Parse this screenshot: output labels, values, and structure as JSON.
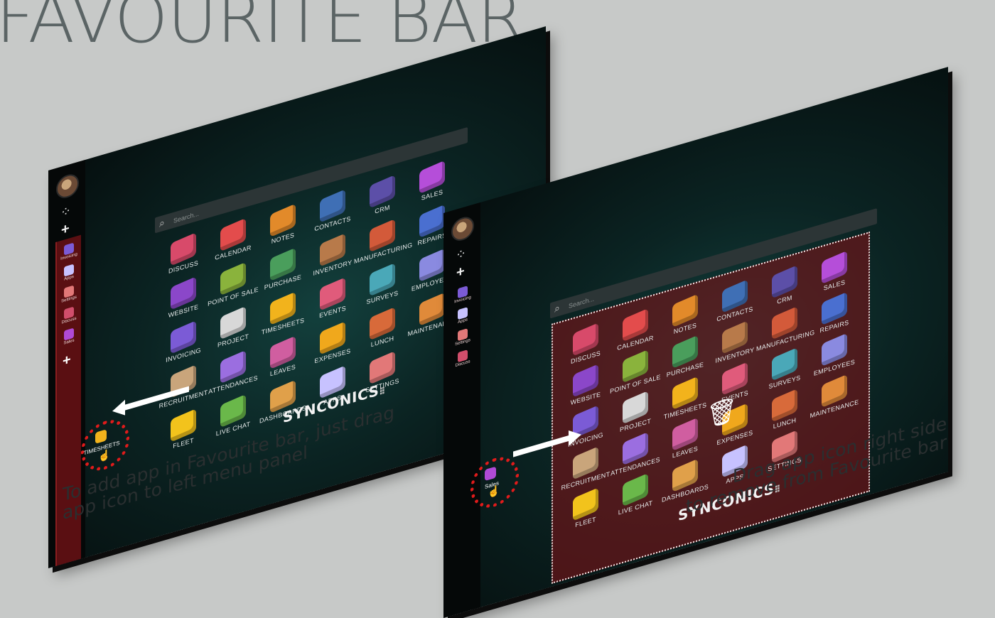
{
  "title": "FAVOURITE BAR",
  "captions": {
    "left": [
      "To add app in Favourite bar, just drag",
      "app icon to left menu panel"
    ],
    "right": [
      "Drag app icon right side",
      "to remove from Favourite bar"
    ]
  },
  "search": {
    "placeholder": "Search..."
  },
  "brand": {
    "name": "SYNCONICS"
  },
  "colors": {
    "accent_red": "#e01b1b",
    "fav_panel": "#5a0f12",
    "background": "#c7c9c8"
  },
  "left_screen": {
    "favourites": [
      {
        "label": "Invoicing",
        "icon": "invoicing-icon",
        "color": "#7b5bd6"
      },
      {
        "label": "Apps",
        "icon": "apps-icon",
        "color": "#c7c2ff"
      },
      {
        "label": "Settings",
        "icon": "settings-icon",
        "color": "#e27878"
      },
      {
        "label": "Discuss",
        "icon": "discuss-icon",
        "color": "#d04e6b"
      },
      {
        "label": "Sales",
        "icon": "sales-icon",
        "color": "#b04ad6"
      }
    ],
    "dragging": {
      "label": "TIMESHEETS",
      "icon": "timesheets-icon",
      "color": "#f2b31c"
    },
    "apps": [
      {
        "label": "DISCUSS",
        "icon": "discuss-icon",
        "color": "#d84a6a"
      },
      {
        "label": "CALENDAR",
        "icon": "calendar-icon",
        "color": "#e34c4c"
      },
      {
        "label": "NOTES",
        "icon": "notes-icon",
        "color": "#e28a2a"
      },
      {
        "label": "CONTACTS",
        "icon": "contacts-icon",
        "color": "#3f6fb5"
      },
      {
        "label": "CRM",
        "icon": "crm-icon",
        "color": "#5c4fa8"
      },
      {
        "label": "SALES",
        "icon": "sales-icon",
        "color": "#b54ed9"
      },
      {
        "label": "WEBSITE",
        "icon": "website-icon",
        "color": "#8b47c9"
      },
      {
        "label": "POINT OF SALE",
        "icon": "point-of-sale-icon",
        "color": "#8ab33c"
      },
      {
        "label": "PURCHASE",
        "icon": "purchase-icon",
        "color": "#4a9e5c"
      },
      {
        "label": "INVENTORY",
        "icon": "inventory-icon",
        "color": "#b87a4a"
      },
      {
        "label": "MANUFACTURING",
        "icon": "manufacturing-icon",
        "color": "#d35a3a"
      },
      {
        "label": "REPAIRS",
        "icon": "repairs-icon",
        "color": "#4a6fd0"
      },
      {
        "label": "INVOICING",
        "icon": "invoicing-icon",
        "color": "#7b5bd6"
      },
      {
        "label": "PROJECT",
        "icon": "project-icon",
        "color": "#d8d8d8"
      },
      {
        "label": "TIMESHEETS",
        "icon": "timesheets-icon",
        "color": "#f2b31c"
      },
      {
        "label": "EVENTS",
        "icon": "events-icon",
        "color": "#e05b7b"
      },
      {
        "label": "SURVEYS",
        "icon": "surveys-icon",
        "color": "#4aa8b8"
      },
      {
        "label": "EMPLOYEES",
        "icon": "employees-icon",
        "color": "#8a8ae0"
      },
      {
        "label": "RECRUITMENT",
        "icon": "recruitment-icon",
        "color": "#c9a57b"
      },
      {
        "label": "ATTENDANCES",
        "icon": "attendances-icon",
        "color": "#9b6ee0"
      },
      {
        "label": "LEAVES",
        "icon": "leaves-icon",
        "color": "#d05ea0"
      },
      {
        "label": "EXPENSES",
        "icon": "expenses-icon",
        "color": "#f0a81c"
      },
      {
        "label": "LUNCH",
        "icon": "lunch-icon",
        "color": "#d86a3a"
      },
      {
        "label": "MAINTENANCE",
        "icon": "maintenance-icon",
        "color": "#e08a3a"
      },
      {
        "label": "FLEET",
        "icon": "fleet-icon",
        "color": "#f2c31c"
      },
      {
        "label": "LIVE CHAT",
        "icon": "live-chat-icon",
        "color": "#6ab84a"
      },
      {
        "label": "DASHBOARDS",
        "icon": "dashboards-icon",
        "color": "#e0a04a"
      },
      {
        "label": "APPS",
        "icon": "apps-icon",
        "color": "#c7c2ff"
      },
      {
        "label": "SETTINGS",
        "icon": "settings-icon",
        "color": "#e27878"
      }
    ]
  },
  "right_screen": {
    "favourites": [
      {
        "label": "Invoicing",
        "icon": "invoicing-icon",
        "color": "#7b5bd6"
      },
      {
        "label": "Apps",
        "icon": "apps-icon",
        "color": "#c7c2ff"
      },
      {
        "label": "Settings",
        "icon": "settings-icon",
        "color": "#e27878"
      },
      {
        "label": "Discuss",
        "icon": "discuss-icon",
        "color": "#d04e6b"
      }
    ],
    "dragging": {
      "label": "Sales",
      "icon": "sales-icon",
      "color": "#b04ad6"
    },
    "trash": "trash-icon",
    "apps": [
      {
        "label": "DISCUSS",
        "icon": "discuss-icon",
        "color": "#d84a6a"
      },
      {
        "label": "CALENDAR",
        "icon": "calendar-icon",
        "color": "#e34c4c"
      },
      {
        "label": "NOTES",
        "icon": "notes-icon",
        "color": "#e28a2a"
      },
      {
        "label": "CONTACTS",
        "icon": "contacts-icon",
        "color": "#3f6fb5"
      },
      {
        "label": "CRM",
        "icon": "crm-icon",
        "color": "#5c4fa8"
      },
      {
        "label": "SALES",
        "icon": "sales-icon",
        "color": "#b54ed9"
      },
      {
        "label": "WEBSITE",
        "icon": "website-icon",
        "color": "#8b47c9"
      },
      {
        "label": "POINT OF SALE",
        "icon": "point-of-sale-icon",
        "color": "#8ab33c"
      },
      {
        "label": "PURCHASE",
        "icon": "purchase-icon",
        "color": "#4a9e5c"
      },
      {
        "label": "INVENTORY",
        "icon": "inventory-icon",
        "color": "#b87a4a"
      },
      {
        "label": "MANUFACTURING",
        "icon": "manufacturing-icon",
        "color": "#d35a3a"
      },
      {
        "label": "REPAIRS",
        "icon": "repairs-icon",
        "color": "#4a6fd0"
      },
      {
        "label": "INVOICING",
        "icon": "invoicing-icon",
        "color": "#7b5bd6"
      },
      {
        "label": "PROJECT",
        "icon": "project-icon",
        "color": "#d8d8d8"
      },
      {
        "label": "TIMESHEETS",
        "icon": "timesheets-icon",
        "color": "#f2b31c"
      },
      {
        "label": "EVENTS",
        "icon": "events-icon",
        "color": "#e05b7b"
      },
      {
        "label": "SURVEYS",
        "icon": "surveys-icon",
        "color": "#4aa8b8"
      },
      {
        "label": "EMPLOYEES",
        "icon": "employees-icon",
        "color": "#8a8ae0"
      },
      {
        "label": "RECRUITMENT",
        "icon": "recruitment-icon",
        "color": "#c9a57b"
      },
      {
        "label": "ATTENDANCES",
        "icon": "attendances-icon",
        "color": "#9b6ee0"
      },
      {
        "label": "LEAVES",
        "icon": "leaves-icon",
        "color": "#d05ea0"
      },
      {
        "label": "EXPENSES",
        "icon": "expenses-icon",
        "color": "#f0a81c"
      },
      {
        "label": "LUNCH",
        "icon": "lunch-icon",
        "color": "#d86a3a"
      },
      {
        "label": "MAINTENANCE",
        "icon": "maintenance-icon",
        "color": "#e08a3a"
      },
      {
        "label": "FLEET",
        "icon": "fleet-icon",
        "color": "#f2c31c"
      },
      {
        "label": "LIVE CHAT",
        "icon": "live-chat-icon",
        "color": "#6ab84a"
      },
      {
        "label": "DASHBOARDS",
        "icon": "dashboards-icon",
        "color": "#e0a04a"
      },
      {
        "label": "APPS",
        "icon": "apps-icon",
        "color": "#c7c2ff"
      },
      {
        "label": "SETTINGS",
        "icon": "settings-icon",
        "color": "#e27878"
      }
    ]
  }
}
